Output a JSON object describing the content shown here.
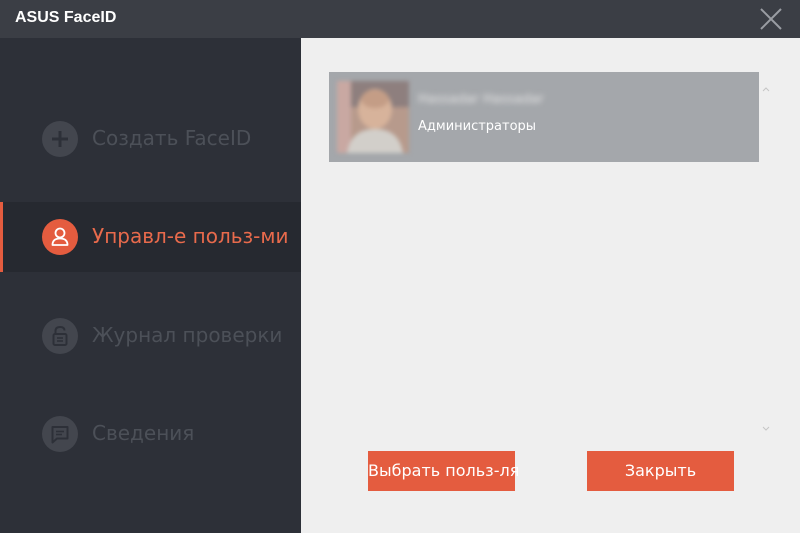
{
  "window": {
    "title": "ASUS FaceID"
  },
  "sidebar": {
    "items": [
      {
        "label": "Создать FaceID",
        "icon": "plus-icon"
      },
      {
        "label": "Управл-е польз-ми",
        "icon": "user-icon",
        "active": true
      },
      {
        "label": "Журнал проверки",
        "icon": "lock-icon"
      },
      {
        "label": "Сведения",
        "icon": "chat-icon"
      }
    ]
  },
  "users": [
    {
      "name": "Hassadar Hassadar",
      "group": "Администраторы"
    }
  ],
  "buttons": {
    "select_user": "Выбрать польз-ля",
    "close": "Закрыть"
  },
  "colors": {
    "accent": "#e45c3f",
    "sidebar": "#2d3038",
    "titlebar": "#3b3e45",
    "content": "#efefef",
    "selected_row": "#a4a7ab"
  }
}
